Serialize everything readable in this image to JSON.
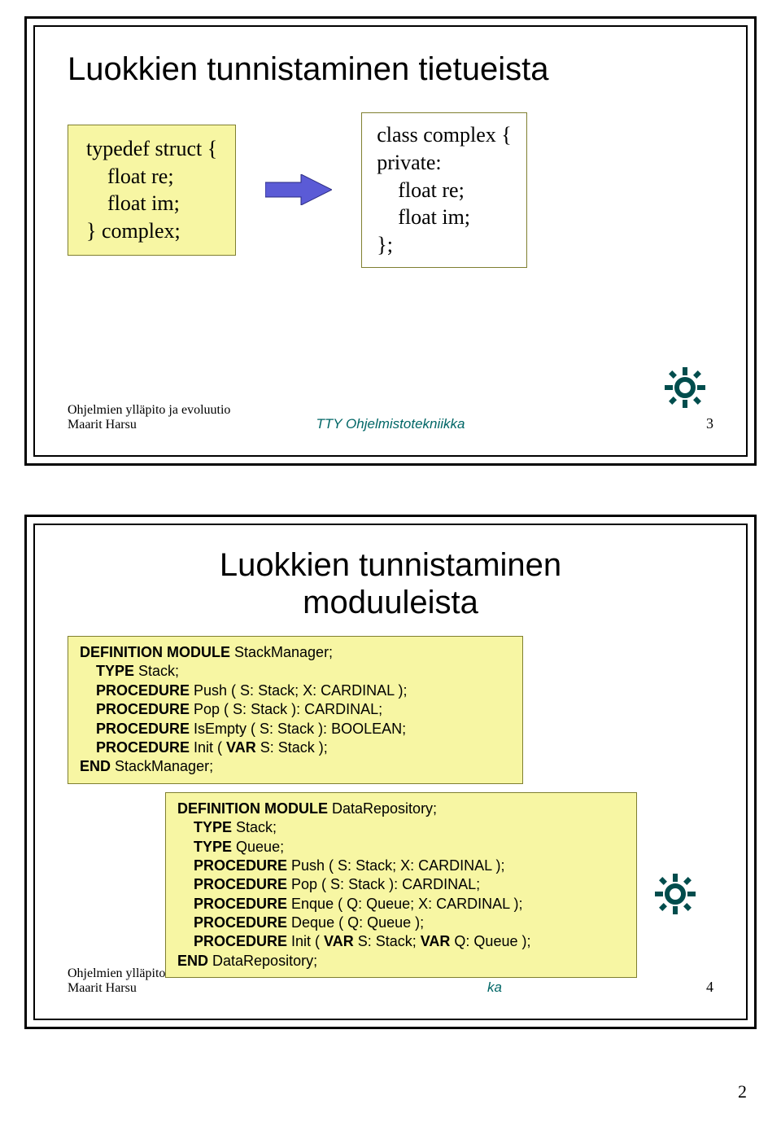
{
  "page_number": "2",
  "slide1": {
    "title": "Luokkien tunnistaminen tietueista",
    "code_left": "typedef struct {\n    float re;\n    float im;\n} complex;",
    "code_right": "class complex {\nprivate:\n    float re;\n    float im;\n};",
    "footer_left_line1": "Ohjelmien ylläpito ja evoluutio",
    "footer_left_line2": "Maarit Harsu",
    "footer_center": "TTY Ohjelmistotekniikka",
    "footer_num": "3",
    "gear_icon": "gear-icon"
  },
  "slide2": {
    "title_line1": "Luokkien tunnistaminen",
    "title_line2": "moduuleista",
    "module1": {
      "l1a": "DEFINITION MODULE",
      "l1b": " StackManager;",
      "l2a": "    TYPE",
      "l2b": " Stack;",
      "l3a": "    PROCEDURE",
      "l3b": " Push ( S: Stack; X: CARDINAL );",
      "l4a": "    PROCEDURE",
      "l4b": " Pop ( S: Stack ): CARDINAL;",
      "l5a": "    PROCEDURE",
      "l5b": " IsEmpty ( S: Stack ): BOOLEAN;",
      "l6a": "    PROCEDURE",
      "l6b": " Init ( ",
      "l6c": "VAR",
      "l6d": " S: Stack );",
      "l7a": "END",
      "l7b": " StackManager;"
    },
    "module2": {
      "l1a": "DEFINITION MODULE",
      "l1b": " DataRepository;",
      "l2a": "    TYPE",
      "l2b": " Stack;",
      "l3a": "    TYPE",
      "l3b": " Queue;",
      "l4a": "    PROCEDURE",
      "l4b": " Push ( S: Stack; X: CARDINAL );",
      "l5a": "    PROCEDURE",
      "l5b": " Pop ( S: Stack ): CARDINAL;",
      "l6a": "    PROCEDURE",
      "l6b": " Enque ( Q: Queue; X: CARDINAL );",
      "l7a": "    PROCEDURE",
      "l7b": " Deque ( Q: Queue );",
      "l8a": "    PROCEDURE",
      "l8b": " Init ( ",
      "l8c": "VAR",
      "l8d": " S: Stack; ",
      "l8e": "VAR",
      "l8f": " Q: Queue );",
      "l9a": "END",
      "l9b": " DataRepository;"
    },
    "footer_left_visible": "Ohjelmien ylläpito",
    "footer_left_line2": "Maarit Harsu",
    "footer_center_fragment": "ka",
    "footer_num": "4",
    "gear_icon": "gear-icon"
  }
}
